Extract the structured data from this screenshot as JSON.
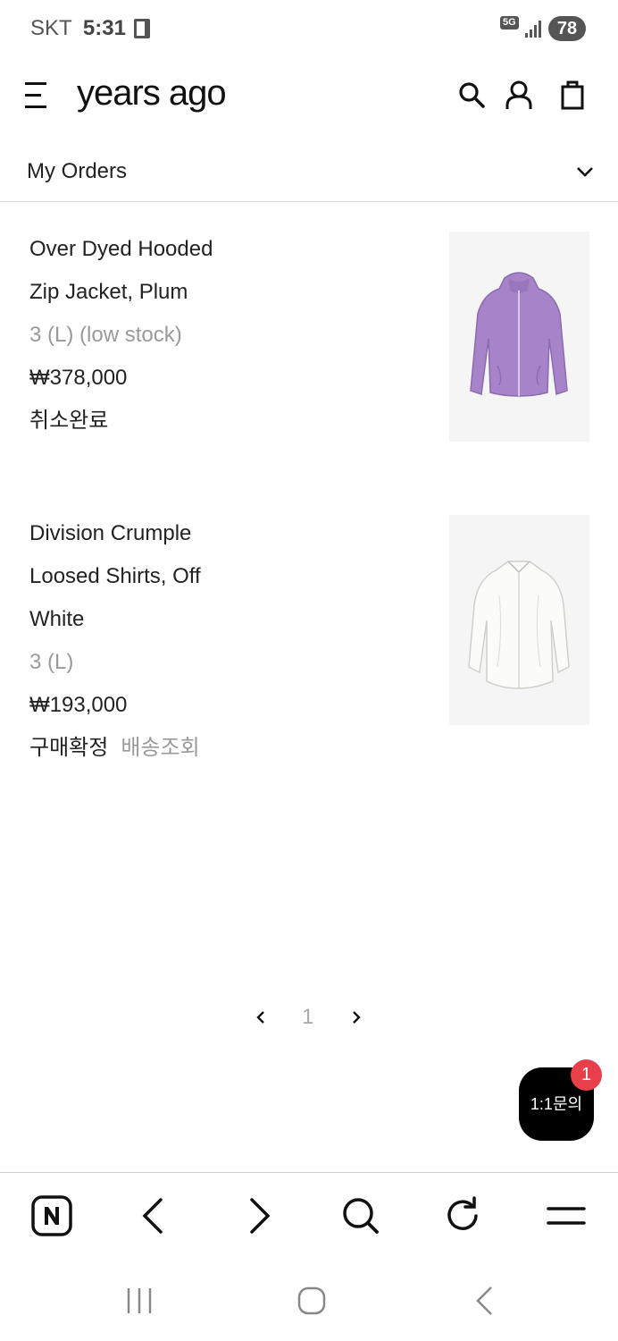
{
  "status_bar": {
    "carrier": "SKT",
    "time": "5:31",
    "network": "5G",
    "battery": "78"
  },
  "header": {
    "brand": "years ago",
    "icons": [
      "hamburger-icon",
      "search-icon",
      "user-icon",
      "shopping-bag-icon"
    ]
  },
  "section": {
    "title": "My Orders"
  },
  "orders": [
    {
      "name_lines": [
        "Over Dyed Hooded",
        "Zip Jacket, Plum"
      ],
      "option": "3 (L) (low stock)",
      "price": "₩378,000",
      "status": "취소완료",
      "image_color": "#a784c9"
    },
    {
      "name_lines": [
        "Division Crumple",
        "Loosed Shirts, Off",
        "White"
      ],
      "option": "3 (L)",
      "price": "₩193,000",
      "status": "구매확정",
      "tracking": "배송조회",
      "image_color": "#f2f2f0"
    }
  ],
  "pagination": {
    "current_page": "1"
  },
  "chat": {
    "label": "1:1문의",
    "badge": "1"
  },
  "browser_toolbar": {
    "icons": [
      "naver-icon",
      "back-icon",
      "forward-icon",
      "search-icon",
      "refresh-icon",
      "menu-icon"
    ]
  },
  "system_nav": {
    "icons": [
      "recent-apps-icon",
      "home-icon",
      "back-icon"
    ]
  }
}
